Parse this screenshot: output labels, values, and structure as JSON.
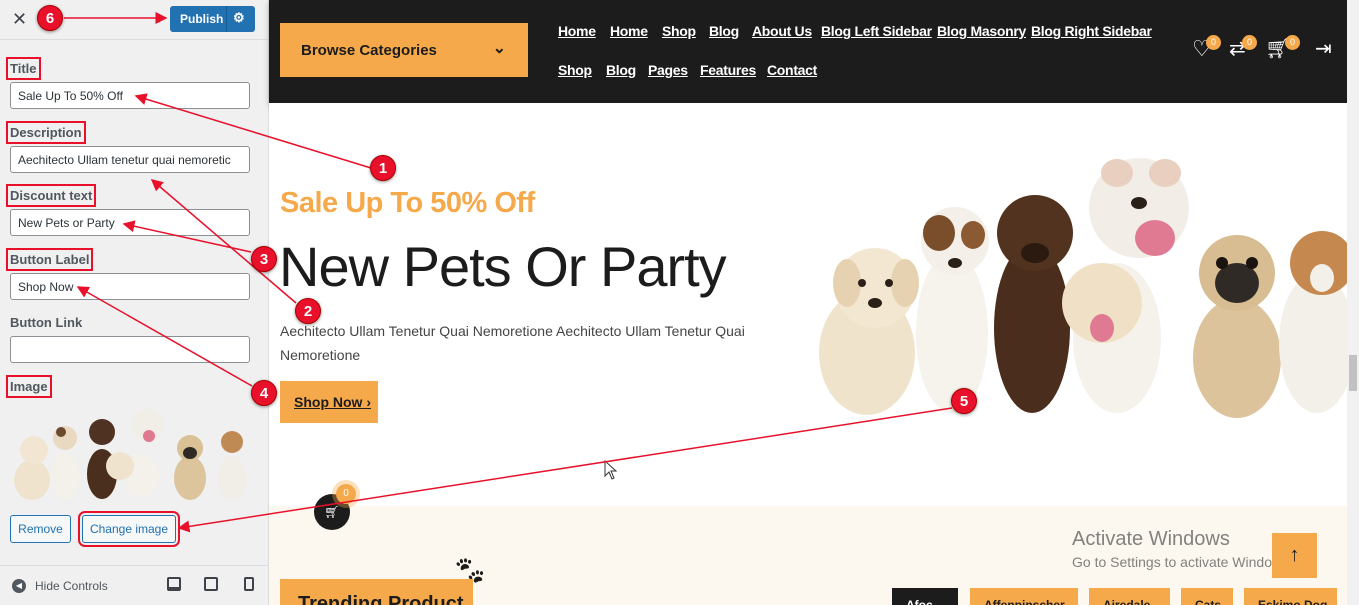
{
  "panel": {
    "publish_label": "Publish",
    "fields": {
      "title_label": "Title",
      "title_value": "Sale Up To 50% Off",
      "description_label": "Description",
      "description_value": "Aechitecto Ullam tenetur quai nemoretic",
      "discount_label": "Discount text",
      "discount_value": "New Pets or Party",
      "button_label_label": "Button Label",
      "button_label_value": "Shop Now",
      "button_link_label": "Button Link",
      "button_link_value": "",
      "image_label": "Image"
    },
    "remove_label": "Remove",
    "change_image_label": "Change image",
    "hide_controls_label": "Hide Controls"
  },
  "header": {
    "browse_label": "Browse Categories",
    "nav_row1": [
      "Home",
      "Home",
      "Shop",
      "Blog",
      "About Us",
      "Blog Left Sidebar",
      "Blog Masonry",
      "Blog Right Sidebar"
    ],
    "nav_row2": [
      "Shop",
      "Blog",
      "Pages",
      "Features",
      "Contact"
    ],
    "wishlist_count": "0",
    "compare_count": "0",
    "cart_count": "0"
  },
  "hero": {
    "subtitle": "Sale Up To 50% Off",
    "title": "New Pets Or Party",
    "description": "Aechitecto Ullam Tenetur Quai Nemoretione Aechitecto Ullam Tenetur Quai Nemoretione",
    "button_label": "Shop Now"
  },
  "trending": {
    "title": "Trending Product",
    "tabs": [
      "Afoc",
      "Affenpinscher",
      "Airedale",
      "Cats",
      "Eskimo Dog"
    ],
    "floating_cart_count": "0"
  },
  "watermark": {
    "line1": "Activate Windows",
    "line2": "Go to Settings to activate Windows."
  },
  "annotations": [
    "1",
    "2",
    "3",
    "4",
    "5",
    "6"
  ],
  "colors": {
    "accent": "#f5a94a",
    "dark": "#1c1c1c",
    "wp_blue": "#2271b1",
    "annotation_red": "#e8102a"
  }
}
